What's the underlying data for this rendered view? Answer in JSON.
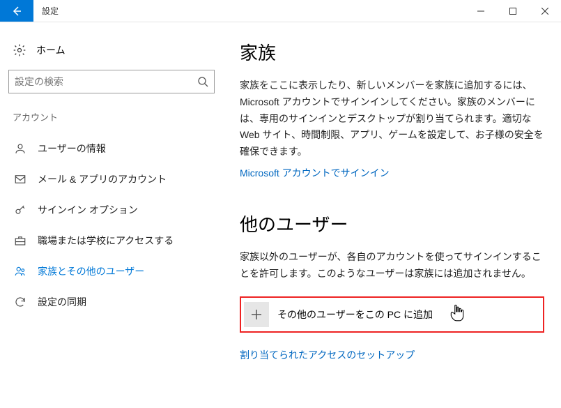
{
  "titlebar": {
    "title": "設定"
  },
  "sidebar": {
    "home_label": "ホーム",
    "search_placeholder": "設定の検索",
    "section_label": "アカウント",
    "items": [
      {
        "label": "ユーザーの情報"
      },
      {
        "label": "メール & アプリのアカウント"
      },
      {
        "label": "サインイン オプション"
      },
      {
        "label": "職場または学校にアクセスする"
      },
      {
        "label": "家族とその他のユーザー"
      },
      {
        "label": "設定の同期"
      }
    ]
  },
  "main": {
    "family_heading": "家族",
    "family_desc": "家族をここに表示したり、新しいメンバーを家族に追加するには、Microsoft アカウントでサインインしてください。家族のメンバーには、専用のサインインとデスクトップが割り当てられます。適切な Web サイト、時間制限、アプリ、ゲームを設定して、お子様の安全を確保できます。",
    "signin_link": "Microsoft アカウントでサインイン",
    "others_heading": "他のユーザー",
    "others_desc": "家族以外のユーザーが、各自のアカウントを使ってサインインすることを許可します。このようなユーザーは家族には追加されません。",
    "add_other_label": "その他のユーザーをこの PC に追加",
    "assigned_access_link": "割り当てられたアクセスのセットアップ"
  }
}
